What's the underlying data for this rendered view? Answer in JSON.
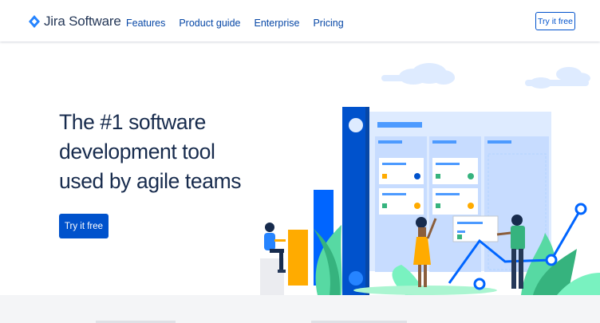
{
  "brand": {
    "name": "Jira Software",
    "logo_icon": "jira-diamond-icon",
    "color": "#2684ff"
  },
  "nav": {
    "items": [
      {
        "label": "Features"
      },
      {
        "label": "Product guide"
      },
      {
        "label": "Enterprise"
      },
      {
        "label": "Pricing"
      }
    ],
    "cta_label": "Try it free"
  },
  "hero": {
    "headline_lines": [
      "The #1 software",
      "development tool",
      "used by agile teams"
    ],
    "cta_label": "Try it free"
  },
  "colors": {
    "primary": "#0052cc",
    "heading": "#172b4d",
    "nav_link": "#0747a6",
    "accent_yellow": "#ffab00",
    "accent_green": "#36b37e",
    "board_bg": "#deebff"
  }
}
